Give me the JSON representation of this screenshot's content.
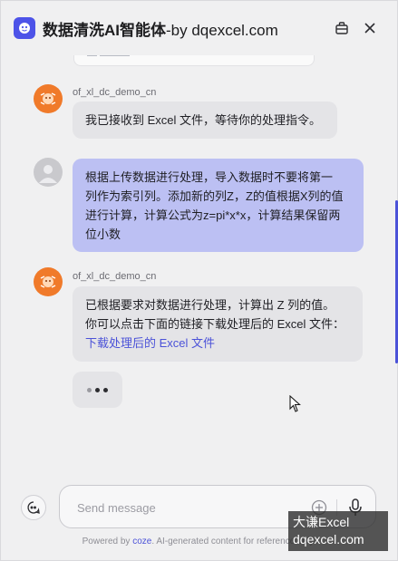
{
  "header": {
    "title_main": "数据清洗AI智能体",
    "title_suffix": "-by dqexcel.com",
    "share_icon": "share-bag-icon",
    "close_icon": "close-icon"
  },
  "messages": [
    {
      "role": "bot",
      "sender": "of_xl_dc_demo_cn",
      "text": "我已接收到 Excel 文件，等待你的处理指令。"
    },
    {
      "role": "user",
      "lines": [
        "根据上传数据进行处理，导入数据时不要将第一",
        "列作为索引列。添加新的列Z，Z的值根据X列的值",
        "进行计算，计算公式为z=pi*x*x，计算结果保留两",
        "位小数"
      ]
    },
    {
      "role": "bot",
      "sender": "of_xl_dc_demo_cn",
      "lines": [
        "已根据要求对数据进行处理，计算出 Z 列的值。",
        "你可以点击下面的链接下载处理后的 Excel 文件："
      ],
      "link_text": "下载处理后的 Excel 文件"
    }
  ],
  "composer": {
    "placeholder": "Send message",
    "new_chat_icon": "new-chat-icon",
    "add_icon": "plus-circle-icon",
    "mic_icon": "microphone-icon"
  },
  "footer": {
    "prefix": "Powered by ",
    "brand": "coze",
    "suffix": ". AI-generated content for reference only."
  },
  "watermark": {
    "line1": "大谦Excel",
    "line2": "dqexcel.com"
  },
  "colors": {
    "accent": "#4d53e8",
    "user_bubble": "#bcc0f3",
    "bot_bubble": "#e4e4e7",
    "bot_avatar": "#f07a2a"
  }
}
